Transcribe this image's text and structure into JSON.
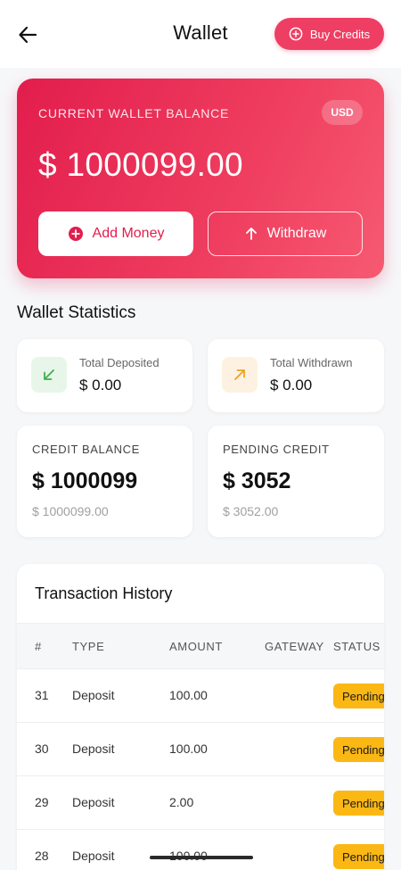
{
  "header": {
    "title": "Wallet",
    "buy_label": "Buy Credits"
  },
  "balance_card": {
    "label": "CURRENT WALLET BALANCE",
    "currency": "USD",
    "amount": "$ 1000099.00",
    "add_money_label": "Add Money",
    "withdraw_label": "Withdraw"
  },
  "stats": {
    "title": "Wallet Statistics",
    "deposited": {
      "label": "Total Deposited",
      "value": "$ 0.00",
      "icon": "arrow-down-left-icon"
    },
    "withdrawn": {
      "label": "Total Withdrawn",
      "value": "$ 0.00",
      "icon": "arrow-up-right-icon"
    },
    "credit_balance": {
      "label": "CREDIT BALANCE",
      "value": "$ 1000099",
      "sub": "$ 1000099.00"
    },
    "pending_credit": {
      "label": "PENDING CREDIT",
      "value": "$ 3052",
      "sub": "$ 3052.00"
    }
  },
  "transactions": {
    "title": "Transaction History",
    "columns": [
      "#",
      "TYPE",
      "AMOUNT",
      "GATEWAY",
      "STATUS"
    ],
    "rows": [
      {
        "id": "31",
        "type": "Deposit",
        "amount": "100.00",
        "gateway": "",
        "status": "Pending"
      },
      {
        "id": "30",
        "type": "Deposit",
        "amount": "100.00",
        "gateway": "",
        "status": "Pending"
      },
      {
        "id": "29",
        "type": "Deposit",
        "amount": "2.00",
        "gateway": "",
        "status": "Pending"
      },
      {
        "id": "28",
        "type": "Deposit",
        "amount": "100.00",
        "gateway": "",
        "status": "Pending"
      }
    ]
  },
  "colors": {
    "accent": "#ef3e63",
    "status_pending": "#fbb814",
    "deposit_icon": "#3fae4f",
    "withdraw_icon": "#f0a020"
  }
}
